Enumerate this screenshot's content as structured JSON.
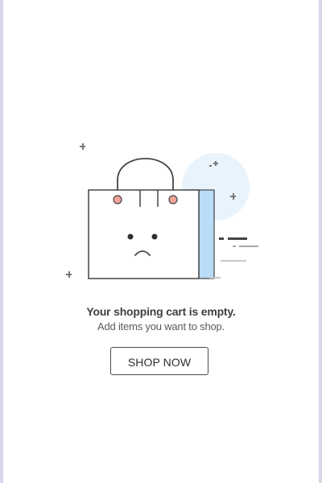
{
  "empty_state": {
    "illustration_icon": "empty-shopping-bag-icon",
    "title": "Your shopping cart is empty.",
    "subtitle": "Add items you want to shop.",
    "button_label": "SHOP NOW"
  },
  "colors": {
    "background_left_edge": "#d9d6e8",
    "surface": "#ffffff",
    "bag_stroke": "#444444",
    "bag_side": "#b9dcf7",
    "bubble": "#e8f3fc",
    "handle_ring": "#f3a39a",
    "text_primary": "#3f3f3f",
    "text_secondary": "#5a5a5a"
  }
}
